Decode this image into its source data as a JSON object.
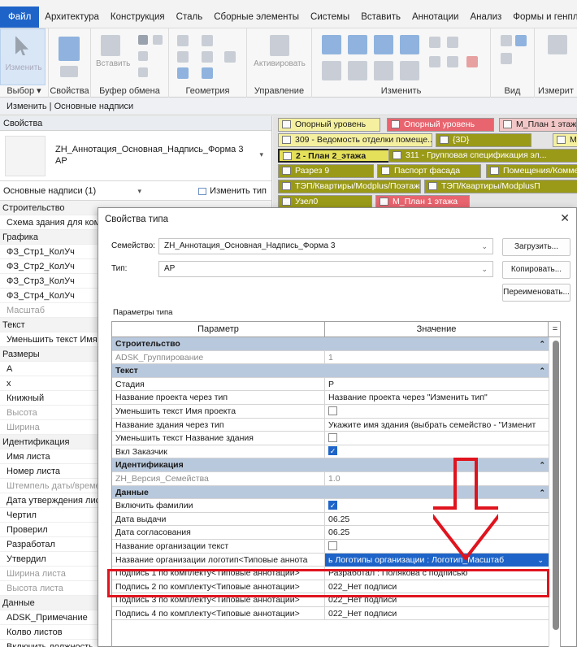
{
  "ribbon": {
    "tabs": [
      {
        "label": "Файл"
      },
      {
        "label": "Архитектура"
      },
      {
        "label": "Конструкция"
      },
      {
        "label": "Сталь"
      },
      {
        "label": "Сборные элементы"
      },
      {
        "label": "Системы"
      },
      {
        "label": "Вставить"
      },
      {
        "label": "Аннотации"
      },
      {
        "label": "Анализ"
      },
      {
        "label": "Формы и генпл"
      }
    ],
    "select_button_label": "Изменить",
    "paste_label": "Вставить",
    "activate_label": "Активировать",
    "groups": {
      "select": "Выбор ▾",
      "properties": "Свойства",
      "clipboard": "Буфер обмена",
      "geometry": "Геометрия",
      "control": "Управление",
      "modify": "Изменить",
      "view": "Вид",
      "measure": "Измерит"
    }
  },
  "modebar": {
    "text": "Изменить | Основные надписи"
  },
  "properties": {
    "title": "Свойства",
    "type_name": "ZH_Аннотация_Основная_Надпись_Форма 3 АР",
    "filter": "Основные надписи (1)",
    "edit_type": "Изменить тип",
    "rows": [
      {
        "text": "Строительство",
        "kind": "cat"
      },
      {
        "text": "Схема здания для комп",
        "kind": ""
      },
      {
        "text": "Графика",
        "kind": "cat"
      },
      {
        "text": "ФЗ_Стр1_КолУч",
        "kind": ""
      },
      {
        "text": "ФЗ_Стр2_КолУч",
        "kind": ""
      },
      {
        "text": "ФЗ_Стр3_КолУч",
        "kind": ""
      },
      {
        "text": "ФЗ_Стр4_КолУч",
        "kind": ""
      },
      {
        "text": "Масштаб",
        "kind": "gray"
      },
      {
        "text": "Текст",
        "kind": "cat"
      },
      {
        "text": "Уменьшить текст Имя",
        "kind": ""
      },
      {
        "text": "Размеры",
        "kind": "cat"
      },
      {
        "text": "А",
        "kind": ""
      },
      {
        "text": "х",
        "kind": ""
      },
      {
        "text": "Книжный",
        "kind": ""
      },
      {
        "text": "Высота",
        "kind": "gray"
      },
      {
        "text": "Ширина",
        "kind": "gray"
      },
      {
        "text": "Идентификация",
        "kind": "cat"
      },
      {
        "text": "Имя листа",
        "kind": ""
      },
      {
        "text": "Номер листа",
        "kind": ""
      },
      {
        "text": "Штемпель даты/време",
        "kind": "gray"
      },
      {
        "text": "Дата утверждения лис",
        "kind": ""
      },
      {
        "text": "Чертил",
        "kind": ""
      },
      {
        "text": "Проверил",
        "kind": ""
      },
      {
        "text": "Разработал",
        "kind": ""
      },
      {
        "text": "Утвердил",
        "kind": ""
      },
      {
        "text": "Ширина листа",
        "kind": "gray"
      },
      {
        "text": "Высота листа",
        "kind": "gray"
      },
      {
        "text": "Данные",
        "kind": "cat"
      },
      {
        "text": "ADSK_Примечание",
        "kind": ""
      },
      {
        "text": "Колво листов",
        "kind": ""
      },
      {
        "text": "Включить должность",
        "kind": ""
      }
    ]
  },
  "view_tabs": [
    {
      "label": "Опорный уровень",
      "color": "#f5f0a0"
    },
    {
      "label": "Опорный уровень",
      "color": "#e8646e"
    },
    {
      "label": "М_План 1 этаж",
      "color": "#f3c7c7"
    },
    {
      "label": "309 - Ведомость отделки помеще...",
      "color": "#f5f0a0"
    },
    {
      "label": "{3D}",
      "color": "#9a9a18"
    },
    {
      "label": "М",
      "color": "#f5f0a0"
    },
    {
      "label": "2 - План 2_этажа",
      "color": "#e5e05a"
    },
    {
      "label": "311 - Групповая спецификация эл...",
      "color": "#9a9a18"
    },
    {
      "label": "Разрез 9",
      "color": "#9a9a18"
    },
    {
      "label": "Паспорт фасада",
      "color": "#9a9a18"
    },
    {
      "label": "Помещения/Коммер",
      "color": "#9a9a18"
    },
    {
      "label": "ТЭП/Квартиры/Modplus/Поэтажно",
      "color": "#9a9a18"
    },
    {
      "label": "ТЭП/Квартиры/ModplusП",
      "color": "#9a9a18"
    },
    {
      "label": "Узел0",
      "color": "#9a9a18"
    },
    {
      "label": "М_План 1 этажа",
      "color": "#e8646e"
    }
  ],
  "dialog": {
    "title": "Свойства типа",
    "family_label": "Семейство:",
    "family_value": "ZH_Аннотация_Основная_Надпись_Форма 3",
    "type_label": "Тип:",
    "type_value": "АР",
    "load_button": "Загрузить...",
    "copy_button": "Копировать...",
    "rename_button": "Переименовать...",
    "params_label": "Параметры типа",
    "col_param": "Параметр",
    "col_value": "Значение",
    "col_sort": "=",
    "rows": [
      {
        "kind": "cat",
        "param": "Строительство",
        "value": ""
      },
      {
        "kind": "gray",
        "param": "ADSK_Группирование",
        "value": "1"
      },
      {
        "kind": "cat",
        "param": "Текст",
        "value": ""
      },
      {
        "kind": "",
        "param": "Стадия",
        "value": "Р"
      },
      {
        "kind": "",
        "param": "Название проекта через тип",
        "value": "Название проекта через \"Изменить тип\""
      },
      {
        "kind": "cb",
        "param": "Уменьшить текст Имя проекта",
        "value": "off"
      },
      {
        "kind": "",
        "param": "Название здания через тип",
        "value": "Укажите имя здания (выбрать семейство - \"Изменит"
      },
      {
        "kind": "cb",
        "param": "Уменьшить текст Название здания",
        "value": "off"
      },
      {
        "kind": "cb",
        "param": "Вкл Заказчик",
        "value": "on"
      },
      {
        "kind": "cat",
        "param": "Идентификация",
        "value": ""
      },
      {
        "kind": "gray",
        "param": "ZH_Версия_Семейства",
        "value": "1.0"
      },
      {
        "kind": "cat",
        "param": "Данные",
        "value": ""
      },
      {
        "kind": "cb",
        "param": "Включить фамилии",
        "value": "on"
      },
      {
        "kind": "",
        "param": "Дата выдачи",
        "value": "06.25"
      },
      {
        "kind": "",
        "param": "Дата согласования",
        "value": "06.25"
      },
      {
        "kind": "cb",
        "param": "Название организации текст",
        "value": "off"
      },
      {
        "kind": "sel",
        "param": "Название организации логотип<Типовые аннота",
        "value": "ь Логотипы организации : Логотип_Масштаб"
      },
      {
        "kind": "",
        "param": "Подпись 1 по комплекту<Типовые аннотации>",
        "value": "Разработал : Полякова с подписью"
      },
      {
        "kind": "",
        "param": "Подпись 2 по комплекту<Типовые аннотации>",
        "value": "022_Нет подписи"
      },
      {
        "kind": "",
        "param": "Подпись 3 по комплекту<Типовые аннотации>",
        "value": "022_Нет подписи"
      },
      {
        "kind": "",
        "param": "Подпись 4 по комплекту<Типовые аннотации>",
        "value": "022_Нет подписи"
      }
    ]
  },
  "colors": {
    "accent": "#1e64c8",
    "annotation": "#e0141e",
    "category": "#b9c9dd"
  },
  "icons": [
    "select-cursor-icon",
    "properties-icon",
    "paste-icon",
    "close-icon",
    "chevron-down-icon",
    "checkbox-icon",
    "edit-type-icon",
    "view-tab-icon"
  ]
}
